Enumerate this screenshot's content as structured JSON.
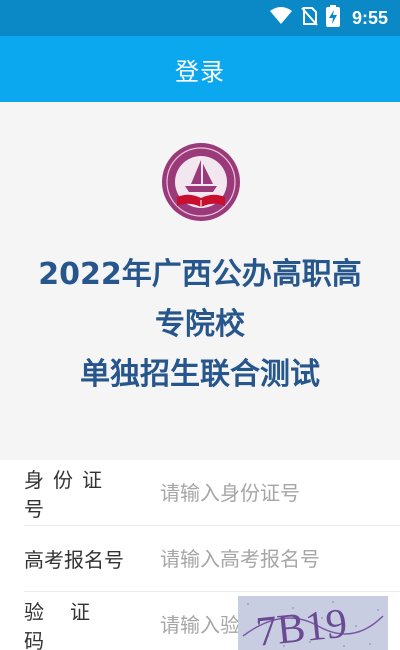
{
  "status_bar": {
    "time": "9:55",
    "icons": [
      "wifi-icon",
      "sim-none-icon",
      "battery-charging-icon"
    ]
  },
  "app_bar": {
    "title": "登录"
  },
  "hero": {
    "title_line1": "2022年广西公办高职高",
    "title_line2": "专院校",
    "title_line3": "单独招生联合测试",
    "logo": "seal-book-boat-logo"
  },
  "form": {
    "id_label": "身份证号",
    "id_placeholder": "请输入身份证号",
    "exam_label": "高考报名号",
    "exam_placeholder": "请输入高考报名号",
    "captcha_label": "验证码",
    "captcha_placeholder": "请输入验证码",
    "captcha_text": "7B19"
  },
  "colors": {
    "status_bar": "#0a89c6",
    "app_bar": "#0ba8f0",
    "title": "#26568c",
    "seal": "#9b3a7a"
  }
}
